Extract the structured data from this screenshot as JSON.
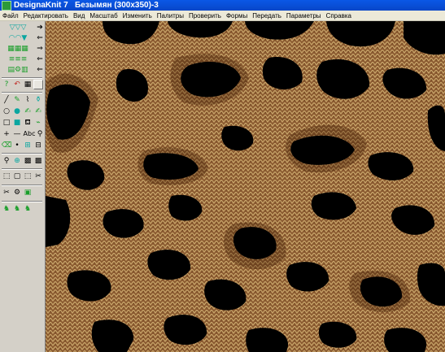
{
  "window": {
    "app_name": "DesignaKnit 7",
    "document_title": "Безымян (300x350)-3"
  },
  "menu": {
    "items": [
      "Файл",
      "Редактировать",
      "Вид",
      "Масштаб",
      "Изменить",
      "Палитры",
      "Проверить",
      "Формы",
      "Передать",
      "Параметры",
      "Справка"
    ]
  },
  "toolbox": {
    "text_tool_label": "Abc"
  },
  "canvas": {
    "pattern": "leopard-print knit",
    "colors": {
      "background": "#8a5a30",
      "light_stitch": "#c9a56a",
      "spot": "#000000"
    }
  }
}
